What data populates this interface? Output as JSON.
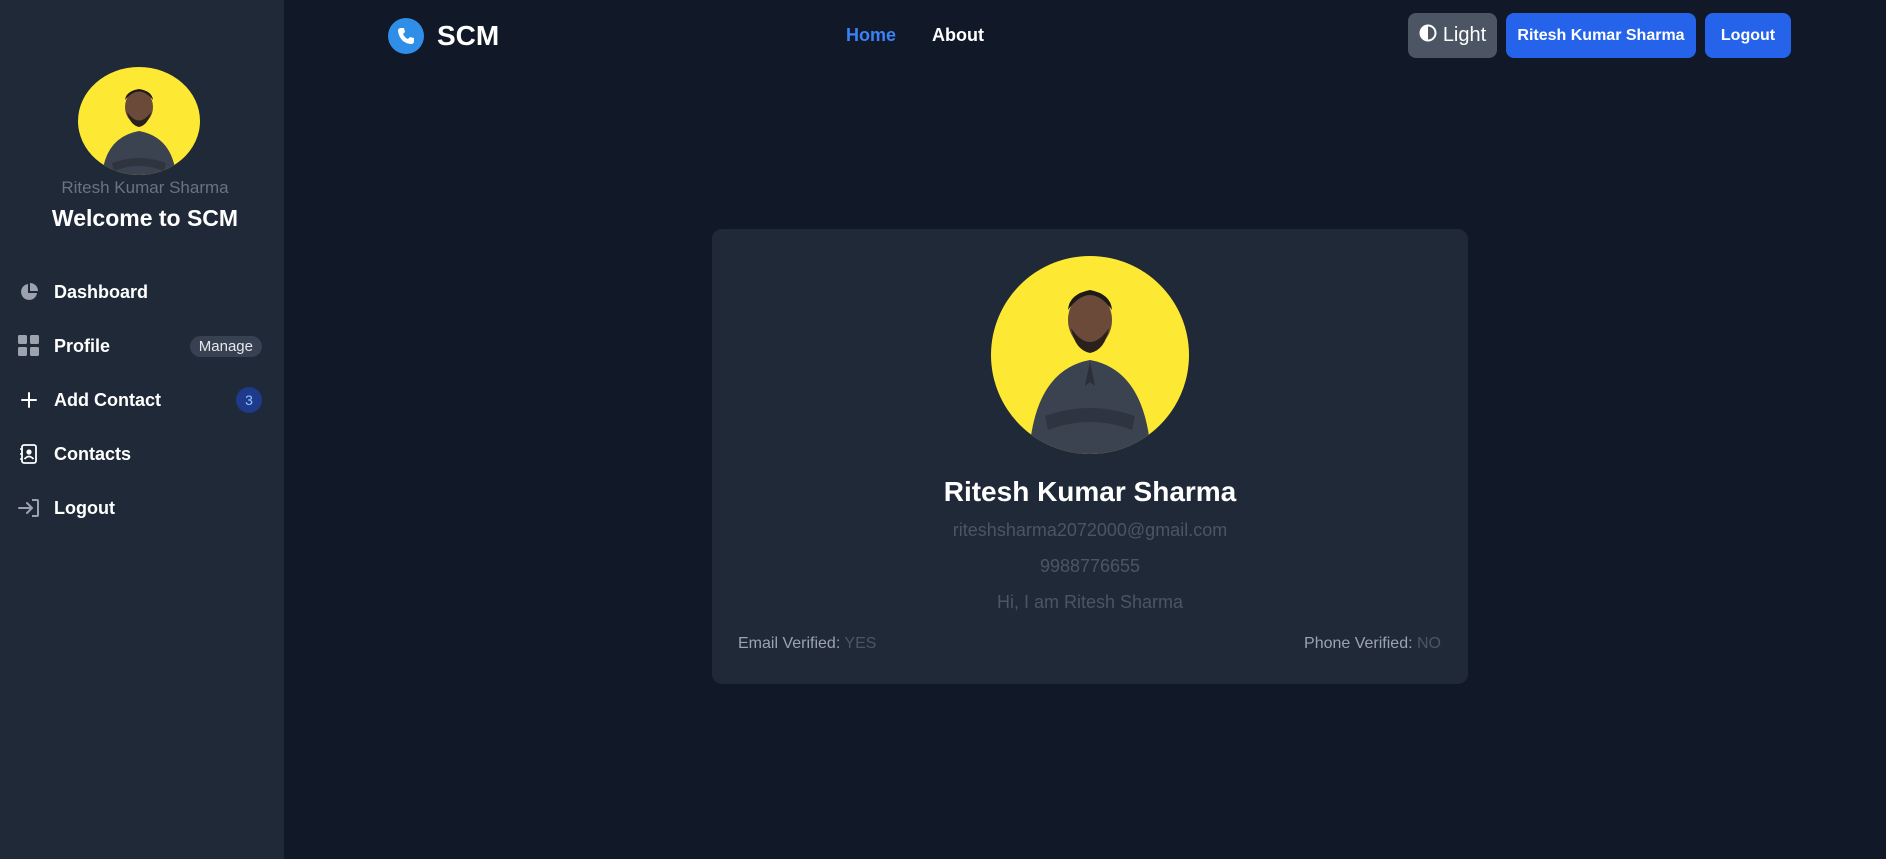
{
  "app": {
    "logo_text": "SCM",
    "brand_color": "#2f8fe8"
  },
  "topnav": {
    "home": "Home",
    "about": "About",
    "theme_label": "Light",
    "user_button": "Ritesh Kumar Sharma",
    "logout_button": "Logout"
  },
  "sidebar": {
    "username": "Ritesh Kumar Sharma",
    "welcome": "Welcome to SCM",
    "items": [
      {
        "label": "Dashboard",
        "icon": "pie-chart-icon"
      },
      {
        "label": "Profile",
        "icon": "grid-icon",
        "badge": "Manage"
      },
      {
        "label": "Add Contact",
        "icon": "plus-icon",
        "badge": "3"
      },
      {
        "label": "Contacts",
        "icon": "contact-book-icon"
      },
      {
        "label": "Logout",
        "icon": "sign-in-icon"
      }
    ]
  },
  "profile": {
    "name": "Ritesh Kumar Sharma",
    "email": "riteshsharma2072000@gmail.com",
    "phone": "9988776655",
    "about": "Hi, I am Ritesh Sharma",
    "email_verified_label": "Email Verified:",
    "email_verified_value": "YES",
    "phone_verified_label": "Phone Verified:",
    "phone_verified_value": "NO"
  },
  "colors": {
    "background": "#111827",
    "sidebar": "#1f2937",
    "card": "#1f2937",
    "accent": "#2563eb",
    "avatar_bg": "#fde933"
  }
}
